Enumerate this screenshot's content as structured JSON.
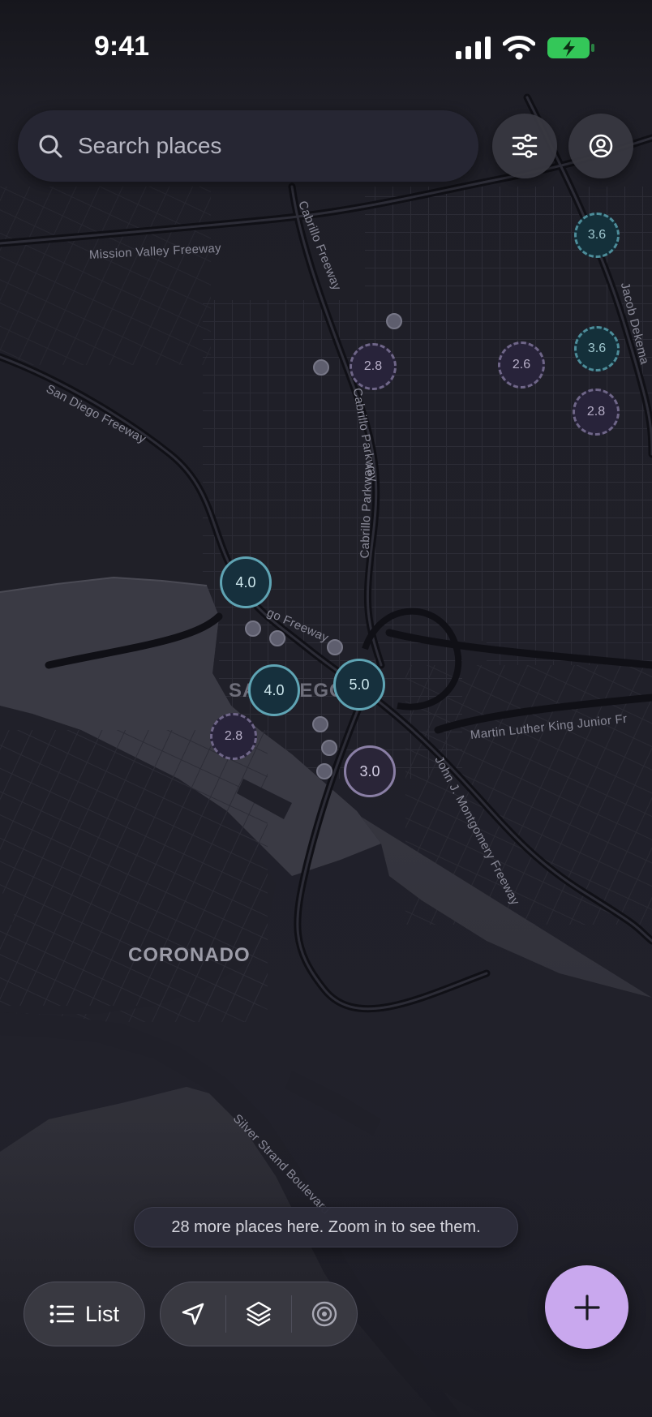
{
  "status_bar": {
    "time": "9:41",
    "battery_color": "#34c759"
  },
  "search": {
    "placeholder": "Search places"
  },
  "header_buttons": {
    "filter_icon": "sliders-icon",
    "profile_icon": "user-circle-icon"
  },
  "map_labels": {
    "mission_valley": "Mission Valley Freeway",
    "san_diego_fwy": "San Diego Freeway",
    "cabrillo_fwy": "Cabrillo Freeway",
    "cabrillo_pkwy_1": "Cabrillo Parkway",
    "cabrillo_pkwy_2": "Cabrillo Parkway",
    "jacob_dekema": "Jacob Dekema",
    "mlk": "Martin Luther King Junior Fr",
    "montgomery": "John J. Montgomery Freeway",
    "san_diego_fwy_2": "go Freeway",
    "san_diego_city": "SAN DIEGO",
    "coronado": "CORONADO",
    "silver_strand": "Silver Strand Boulevard"
  },
  "markers": [
    {
      "label": "3.6",
      "style": "dashed-teal"
    },
    {
      "label": "3.6",
      "style": "dashed-teal"
    },
    {
      "label": "2.8",
      "style": "dashed-purple"
    },
    {
      "label": "2.6",
      "style": "dashed-purple"
    },
    {
      "label": "2.8",
      "style": "dashed-purple"
    },
    {
      "label": "4.0",
      "style": "solid-teal"
    },
    {
      "label": "4.0",
      "style": "solid-teal"
    },
    {
      "label": "5.0",
      "style": "solid-teal"
    },
    {
      "label": "2.8",
      "style": "dashed-purple"
    },
    {
      "label": "3.0",
      "style": "solid-purple"
    }
  ],
  "toast": {
    "message": "28 more places here. Zoom in to see them."
  },
  "bottom": {
    "list_label": "List",
    "navigate_icon": "navigation-arrow-icon",
    "layers_icon": "layers-icon",
    "locate_icon": "target-icon",
    "add_icon": "plus-icon",
    "fab_color": "#c9a8ee"
  }
}
